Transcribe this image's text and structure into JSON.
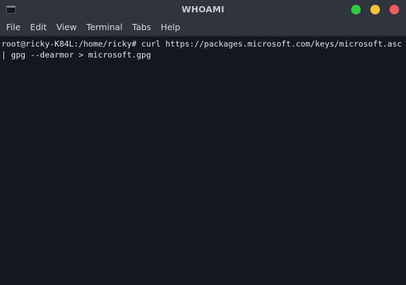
{
  "window": {
    "title": "WHOAMI",
    "icon": "terminal-icon",
    "controls": {
      "maximize_color": "#2ecc40",
      "minimize_color": "#f7c03a",
      "close_color": "#f25c5c"
    }
  },
  "menubar": {
    "items": [
      "File",
      "Edit",
      "View",
      "Terminal",
      "Tabs",
      "Help"
    ]
  },
  "terminal": {
    "background": "#131722",
    "lines": [
      "root@ricky-K84L:/home/ricky# curl https://packages.microsoft.com/keys/microsoft.asc",
      "| gpg --dearmor > microsoft.gpg"
    ]
  }
}
